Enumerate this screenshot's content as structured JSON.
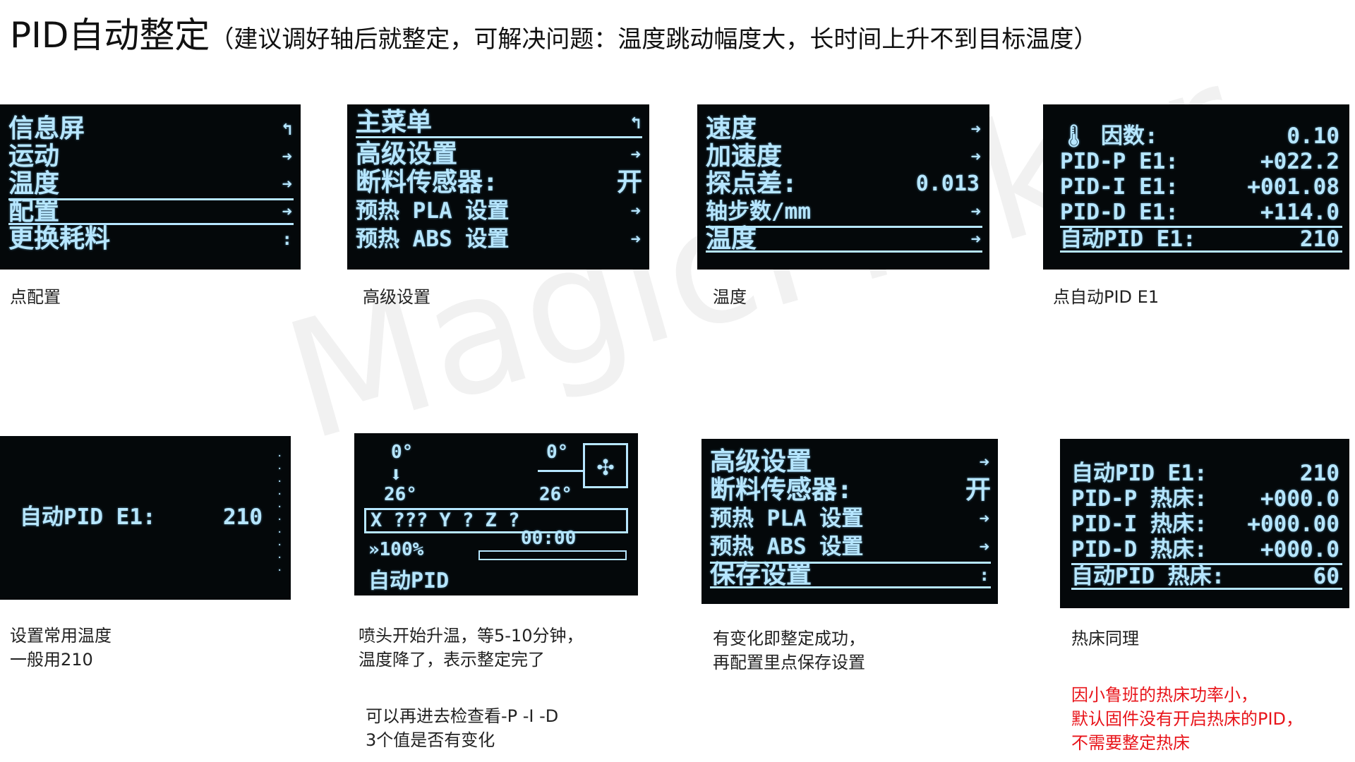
{
  "header": {
    "title_main": "PID自动整定",
    "title_sub": "（建议调好轴后就整定，可解决问题：温度跳动幅度大，长时间上升不到目标温度）"
  },
  "watermark": "MagicMaker",
  "screens": {
    "s1": {
      "rows": [
        {
          "label": "信息屏",
          "arrow": "↰"
        },
        {
          "label": "运动",
          "arrow": "➜"
        },
        {
          "label": "温度",
          "arrow": "➜"
        },
        {
          "label": "配置",
          "arrow": "➜"
        },
        {
          "label": "更换耗料",
          "arrow": ":"
        }
      ],
      "caption": "点配置"
    },
    "s2": {
      "rows": [
        {
          "label": "主菜单",
          "arrow": "↰"
        },
        {
          "label": "高级设置",
          "arrow": "➜"
        },
        {
          "label": "断料传感器:",
          "value": "开"
        },
        {
          "label": "预热 PLA 设置",
          "arrow": "➜"
        },
        {
          "label": "预热 ABS 设置",
          "arrow": "➜"
        }
      ],
      "caption": "高级设置"
    },
    "s3": {
      "rows": [
        {
          "label": "速度",
          "arrow": "➜"
        },
        {
          "label": "加速度",
          "arrow": "➜"
        },
        {
          "label": "探点差:",
          "value": "0.013"
        },
        {
          "label": "轴步数/mm",
          "arrow": "➜"
        },
        {
          "label": "温度",
          "arrow": "➜"
        }
      ],
      "caption": "温度"
    },
    "s4": {
      "rows": [
        {
          "label": "🌡 因数:",
          "value": "0.10"
        },
        {
          "label": "PID-P E1:",
          "value": "+022.2"
        },
        {
          "label": "PID-I E1:",
          "value": "+001.08"
        },
        {
          "label": "PID-D E1:",
          "value": "+114.0"
        },
        {
          "label": "自动PID E1:",
          "value": "210"
        }
      ],
      "caption": "点自动PID  E1"
    },
    "s5": {
      "row": {
        "label": "自动PID E1:",
        "value": "210"
      },
      "caption_lines": [
        "设置常用温度",
        "一般用210"
      ]
    },
    "s6": {
      "hotend_target": "0°",
      "hotend_temp": "26°",
      "bed_target": "0°",
      "bed_temp": "26°",
      "fan_icon": "✣",
      "axis_line": "X ??? Y  ? Z  ?",
      "speed": "»100%",
      "time": "00:00",
      "status": "自动PID",
      "caption_lines": [
        "喷头开始升温，等5-10分钟，",
        "温度降了，表示整定完了"
      ],
      "note_lines": [
        "可以再进去检查看-P -I -D",
        "3个值是否有变化"
      ]
    },
    "s7": {
      "rows": [
        {
          "label": "高级设置",
          "arrow": "➜"
        },
        {
          "label": "断料传感器:",
          "value": "开"
        },
        {
          "label": "预热 PLA 设置",
          "arrow": "➜"
        },
        {
          "label": "预热 ABS 设置",
          "arrow": "➜"
        },
        {
          "label": "保存设置",
          "arrow": ":"
        }
      ],
      "caption_lines": [
        "有变化即整定成功，",
        "再配置里点保存设置"
      ]
    },
    "s8": {
      "rows": [
        {
          "label": "自动PID E1:",
          "value": "210"
        },
        {
          "label": "PID-P 热床:",
          "value": "+000.0"
        },
        {
          "label": "PID-I 热床:",
          "value": "+000.00"
        },
        {
          "label": "PID-D 热床:",
          "value": "+000.0"
        },
        {
          "label": "自动PID 热床:",
          "value": "60"
        }
      ],
      "caption_lines": [
        "热床同理"
      ],
      "note_lines": [
        "因小鲁班的热床功率小，",
        "默认固件没有开启热床的PID，",
        "不需要整定热床"
      ]
    }
  }
}
